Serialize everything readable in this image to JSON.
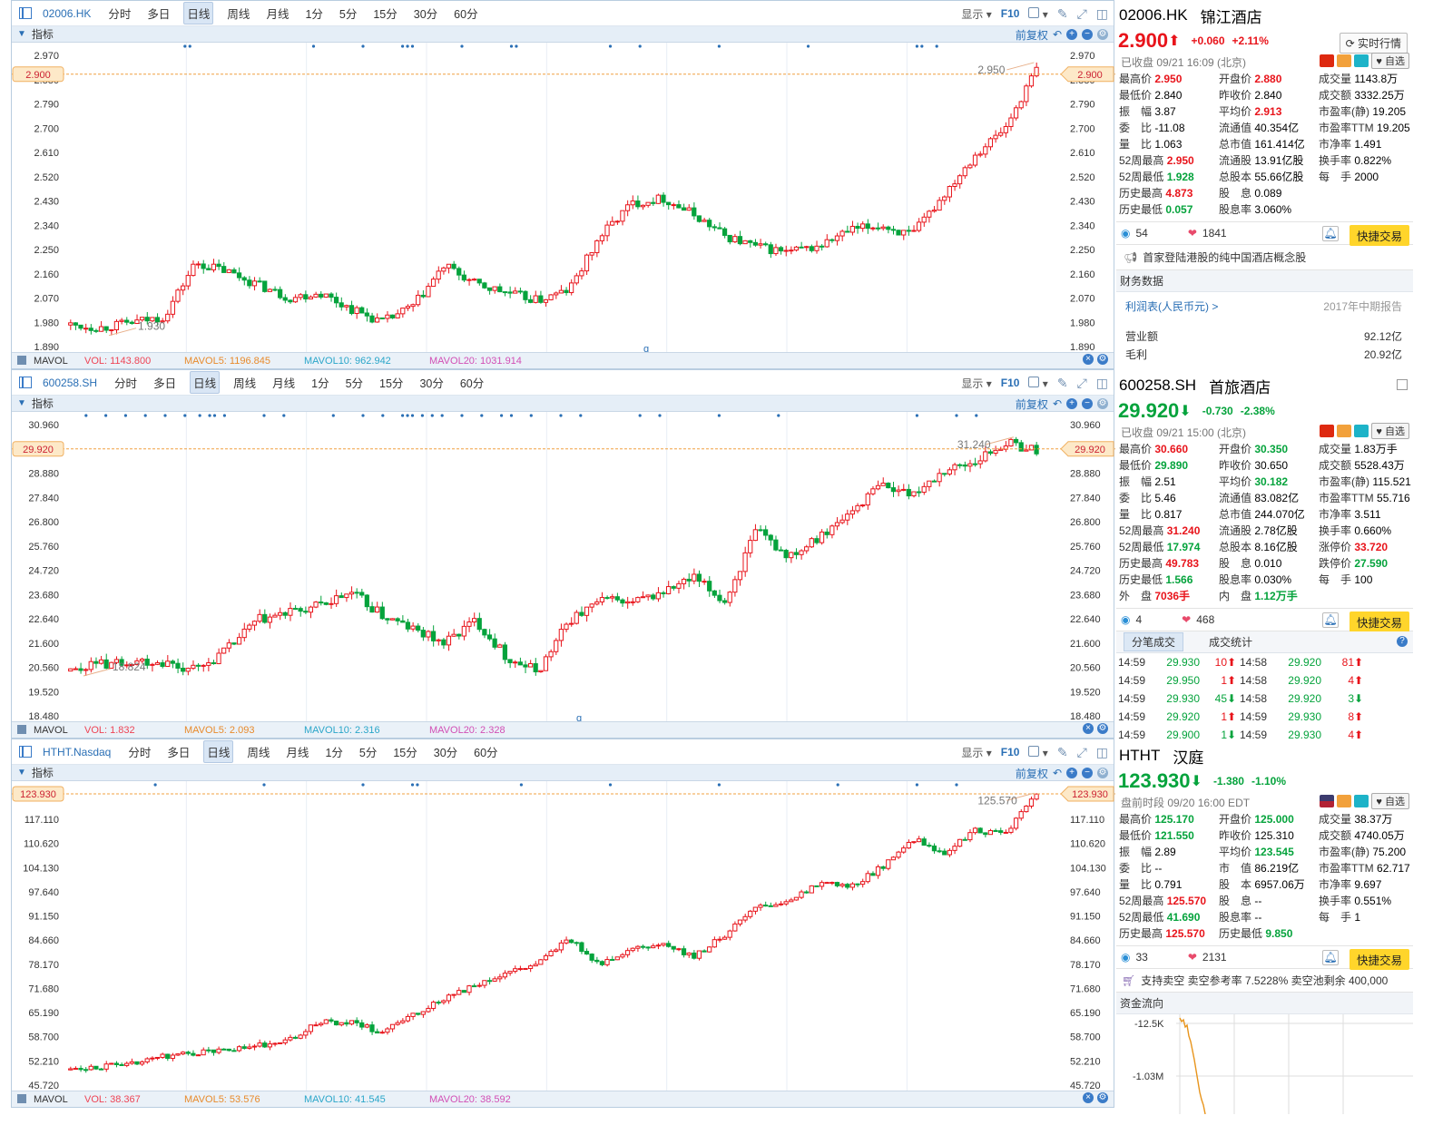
{
  "panels": [
    {
      "symbol": "02006.HK",
      "timeframes": [
        "分时",
        "多日",
        "日线",
        "周线",
        "月线",
        "1分",
        "5分",
        "15分",
        "30分",
        "60分"
      ],
      "active": "日线",
      "display_label": "显示",
      "f10": "F10",
      "indicator_label": "指标",
      "adjust_label": "前复权",
      "yticks": [
        "2.970",
        "2.880",
        "2.790",
        "2.700",
        "2.610",
        "2.520",
        "2.430",
        "2.340",
        "2.250",
        "2.160",
        "2.070",
        "1.980",
        "1.890"
      ],
      "ymin": 1.89,
      "ymax": 2.97,
      "current": "2.900",
      "current_val": 2.9,
      "peak_label": "2.950",
      "low_label": "1.930",
      "marker_q": "q",
      "mavol": "MAVOL",
      "vol": "VOL: 1143.800",
      "mavol5": "MAVOL5: 1196.845",
      "mavol10": "MAVOL10: 962.942",
      "mavol20": "MAVOL20: 1031.914"
    },
    {
      "symbol": "600258.SH",
      "timeframes": [
        "分时",
        "多日",
        "日线",
        "周线",
        "月线",
        "1分",
        "5分",
        "15分",
        "30分",
        "60分"
      ],
      "active": "日线",
      "display_label": "显示",
      "f10": "F10",
      "indicator_label": "指标",
      "adjust_label": "前复权",
      "yticks": [
        "30.960",
        "29.920",
        "28.880",
        "27.840",
        "26.800",
        "25.760",
        "24.720",
        "23.680",
        "22.640",
        "21.600",
        "20.560",
        "19.520",
        "18.480"
      ],
      "ymin": 18.48,
      "ymax": 30.96,
      "current": "29.920",
      "current_val": 29.92,
      "peak_label": "31.240",
      "low_label": "18.824",
      "marker_q": "q",
      "mavol": "MAVOL",
      "vol": "VOL: 1.832",
      "mavol5": "MAVOL5: 2.093",
      "mavol10": "MAVOL10: 2.316",
      "mavol20": "MAVOL20: 2.328"
    },
    {
      "symbol": "HTHT.Nasdaq",
      "timeframes": [
        "分时",
        "多日",
        "日线",
        "周线",
        "月线",
        "1分",
        "5分",
        "15分",
        "30分",
        "60分"
      ],
      "active": "日线",
      "display_label": "显示",
      "f10": "F10",
      "indicator_label": "指标",
      "adjust_label": "前复权",
      "yticks": [
        "123.930",
        "117.110",
        "110.620",
        "104.130",
        "97.640",
        "91.150",
        "84.660",
        "78.170",
        "71.680",
        "65.190",
        "58.700",
        "52.210",
        "45.720"
      ],
      "ymin": 45.72,
      "ymax": 123.93,
      "current": "123.930",
      "current_val": 123.93,
      "peak_label": "125.570",
      "low_label": "",
      "marker_q": "",
      "mavol": "MAVOL",
      "vol": "VOL: 38.367",
      "mavol5": "MAVOL5: 53.576",
      "mavol10": "MAVOL10: 41.545",
      "mavol20": "MAVOL20: 38.592"
    }
  ],
  "q1": {
    "code": "02006.HK",
    "name": "锦江酒店",
    "price": "2.900",
    "arrow": "⬆",
    "chg": "+0.060",
    "pct": "+2.11%",
    "status": "已收盘 09/21 16:09 (北京)",
    "realtime": "实时行情",
    "watch": "自选",
    "rows": [
      [
        "最高价",
        "2.950",
        "r",
        "开盘价",
        "2.880",
        "r",
        "成交量",
        "1143.8万",
        ""
      ],
      [
        "最低价",
        "2.840",
        "",
        "昨收价",
        "2.840",
        "",
        "成交额",
        "3332.25万",
        ""
      ],
      [
        "振　幅",
        "3.87",
        "",
        "平均价",
        "2.913",
        "r",
        "市盈率(静)",
        "19.205",
        ""
      ],
      [
        "委　比",
        "-11.08",
        "",
        "流通值",
        "40.354亿",
        "",
        "市盈率TTM",
        "19.205",
        ""
      ],
      [
        "量　比",
        "1.063",
        "",
        "总市值",
        "161.414亿",
        "",
        "市净率",
        "1.491",
        ""
      ],
      [
        "52周最高",
        "2.950",
        "r",
        "流通股",
        "13.91亿股",
        "",
        "换手率",
        "0.822%",
        ""
      ],
      [
        "52周最低",
        "1.928",
        "g",
        "总股本",
        "55.66亿股",
        "",
        "每　手",
        "2000",
        ""
      ],
      [
        "历史最高",
        "4.873",
        "r",
        "股　息",
        "0.089",
        "",
        "",
        "",
        ""
      ],
      [
        "历史最低",
        "0.057",
        "g",
        "股息率",
        "3.060%",
        "",
        "",
        "",
        ""
      ]
    ],
    "views": "54",
    "likes": "1841",
    "trade": "快捷交易",
    "concept": "首家登陆港股的纯中国酒店概念股",
    "fin_title": "财务数据",
    "fin_link": "利润表(人民币元) >",
    "fin_period": "2017年中期报告",
    "fin_rows": [
      [
        "营业额",
        "92.12亿"
      ],
      [
        "毛利",
        "20.92亿"
      ]
    ]
  },
  "q2": {
    "code": "600258.SH",
    "name": "首旅酒店",
    "price": "29.920",
    "arrow": "⬇",
    "chg": "-0.730",
    "pct": "-2.38%",
    "status": "已收盘 09/21 15:00 (北京)",
    "watch": "自选",
    "rows": [
      [
        "最高价",
        "30.660",
        "r",
        "开盘价",
        "30.350",
        "g",
        "成交量",
        "1.83万手",
        ""
      ],
      [
        "最低价",
        "29.890",
        "g",
        "昨收价",
        "30.650",
        "",
        "成交额",
        "5528.43万",
        ""
      ],
      [
        "振　幅",
        "2.51",
        "",
        "平均价",
        "30.182",
        "g",
        "市盈率(静)",
        "115.521",
        ""
      ],
      [
        "委　比",
        "5.46",
        "",
        "流通值",
        "83.082亿",
        "",
        "市盈率TTM",
        "55.716",
        ""
      ],
      [
        "量　比",
        "0.817",
        "",
        "总市值",
        "244.070亿",
        "",
        "市净率",
        "3.511",
        ""
      ],
      [
        "52周最高",
        "31.240",
        "r",
        "流通股",
        "2.78亿股",
        "",
        "换手率",
        "0.660%",
        ""
      ],
      [
        "52周最低",
        "17.974",
        "g",
        "总股本",
        "8.16亿股",
        "",
        "涨停价",
        "33.720",
        "r"
      ],
      [
        "历史最高",
        "49.783",
        "r",
        "股　息",
        "0.010",
        "",
        "跌停价",
        "27.590",
        "g"
      ],
      [
        "历史最低",
        "1.566",
        "g",
        "股息率",
        "0.030%",
        "",
        "每　手",
        "100",
        ""
      ],
      [
        "外　盘",
        "7036手",
        "r",
        "内　盘",
        "1.12万手",
        "g",
        "",
        "",
        ""
      ]
    ],
    "views": "4",
    "likes": "468",
    "trade": "快捷交易",
    "tab1": "分笔成交",
    "tab2": "成交统计",
    "ticks": [
      [
        "14:59",
        "29.930",
        "10",
        "⬆",
        "14:58",
        "29.920",
        "81",
        "⬆"
      ],
      [
        "14:59",
        "29.950",
        "1",
        "⬆",
        "14:58",
        "29.920",
        "4",
        "⬆"
      ],
      [
        "14:59",
        "29.930",
        "45",
        "⬇",
        "14:58",
        "29.920",
        "3",
        "⬇"
      ],
      [
        "14:59",
        "29.920",
        "1",
        "⬆",
        "14:59",
        "29.930",
        "8",
        "⬆"
      ],
      [
        "14:59",
        "29.900",
        "1",
        "⬇",
        "14:59",
        "29.930",
        "4",
        "⬆"
      ]
    ]
  },
  "q3": {
    "code": "HTHT",
    "name": "汉庭",
    "price": "123.930",
    "arrow": "⬇",
    "chg": "-1.380",
    "pct": "-1.10%",
    "status": "盘前时段 09/20 16:00 EDT",
    "watch": "自选",
    "rows": [
      [
        "最高价",
        "125.170",
        "g",
        "开盘价",
        "125.000",
        "g",
        "成交量",
        "38.37万",
        ""
      ],
      [
        "最低价",
        "121.550",
        "g",
        "昨收价",
        "125.310",
        "",
        "成交额",
        "4740.05万",
        ""
      ],
      [
        "振　幅",
        "2.89",
        "",
        "平均价",
        "123.545",
        "g",
        "市盈率(静)",
        "75.200",
        ""
      ],
      [
        "委　比",
        "--",
        "",
        "市　值",
        "86.219亿",
        "",
        "市盈率TTM",
        "62.717",
        ""
      ],
      [
        "量　比",
        "0.791",
        "",
        "股　本",
        "6957.06万",
        "",
        "市净率",
        "9.697",
        ""
      ],
      [
        "52周最高",
        "125.570",
        "r",
        "股　息",
        "--",
        "",
        "换手率",
        "0.551%",
        ""
      ],
      [
        "52周最低",
        "41.690",
        "g",
        "股息率",
        "--",
        "",
        "每　手",
        "1",
        ""
      ],
      [
        "历史最高",
        "125.570",
        "r",
        "历史最低",
        "9.850",
        "g",
        "",
        "",
        ""
      ]
    ],
    "views": "33",
    "likes": "2131",
    "trade": "快捷交易",
    "short": "支持卖空  卖空参考率 7.5228%  卖空池剩余 400,000",
    "flow_title": "资金流向",
    "flow_y1": "-12.5K",
    "flow_y2": "-1.03M"
  }
}
